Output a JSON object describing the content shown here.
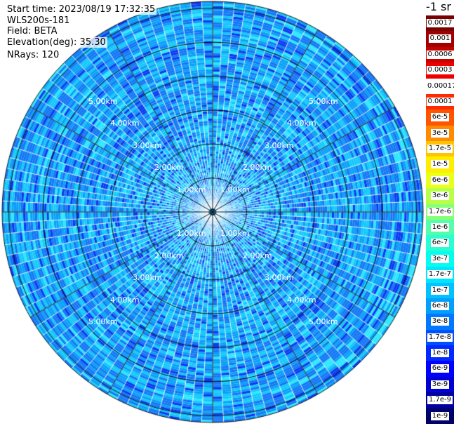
{
  "info": {
    "start_time": "Start time: 2023/08/19 17:32:35",
    "instrument": "WLS200s-181",
    "field": "Field: BETA",
    "elevation": "Elevation(deg): 35.30",
    "nrays": "NRays: 120"
  },
  "units_label": "-1 sr",
  "range_labels": [
    "1.00km",
    "2.00km",
    "3.00km",
    "4.00km",
    "5.00km"
  ],
  "colorbar": [
    {
      "label": "0.0017",
      "color": "#7a0000"
    },
    {
      "label": "0.001",
      "color": "#a00000"
    },
    {
      "label": "0.0006",
      "color": "#c80000"
    },
    {
      "label": "0.0003",
      "color": "#ee0000"
    },
    {
      "label": "0.00017",
      "color": "#ffffff"
    },
    {
      "label": "0.0001",
      "color": "#ff2a00"
    },
    {
      "label": "6e-5",
      "color": "#ff5500"
    },
    {
      "label": "3e-5",
      "color": "#ff8c00"
    },
    {
      "label": "1.7e-5",
      "color": "#ffc400"
    },
    {
      "label": "1e-5",
      "color": "#ffee00"
    },
    {
      "label": "6e-6",
      "color": "#eaff1a"
    },
    {
      "label": "3e-6",
      "color": "#b8ff4a"
    },
    {
      "label": "1.7e-6",
      "color": "#88ff77"
    },
    {
      "label": "1e-6",
      "color": "#55ffaa"
    },
    {
      "label": "6e-7",
      "color": "#2affd4"
    },
    {
      "label": "3e-7",
      "color": "#00ffee"
    },
    {
      "label": "1.7e-7",
      "color": "#00e4ff"
    },
    {
      "label": "1e-7",
      "color": "#00c2ff"
    },
    {
      "label": "6e-8",
      "color": "#00a0ff"
    },
    {
      "label": "3e-8",
      "color": "#0078ff"
    },
    {
      "label": "1.7e-8",
      "color": "#0050ff"
    },
    {
      "label": "1e-8",
      "color": "#002aff"
    },
    {
      "label": "6e-9",
      "color": "#0000ff"
    },
    {
      "label": "3e-9",
      "color": "#0000d0"
    },
    {
      "label": "1.7e-9",
      "color": "#0000a0"
    },
    {
      "label": "1e-9",
      "color": "#00006a"
    }
  ],
  "palette": {
    "deep": "#0a3cf0",
    "blue": "#1478f5",
    "mid": "#0aa0f8",
    "light": "#14c8fa",
    "cyan": "#2ee6ff",
    "grid": "#000000",
    "spoke": "#ffffff"
  },
  "nrays": 120,
  "max_range_km": 6.2
}
